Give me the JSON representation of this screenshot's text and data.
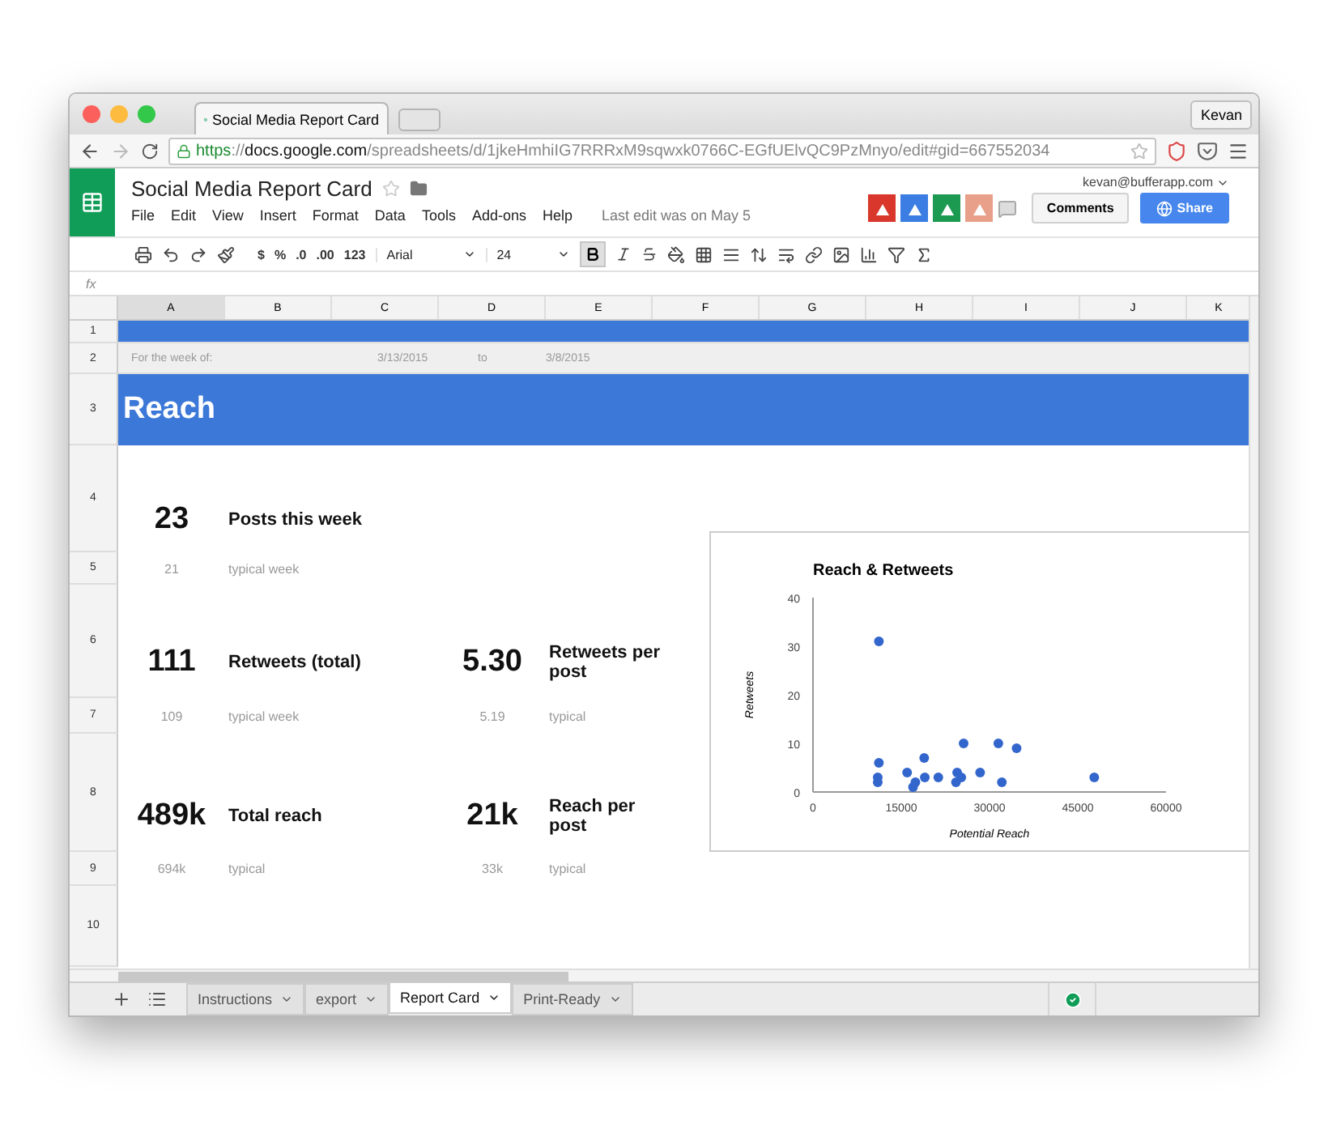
{
  "browser": {
    "tab_title": "Social Media Report Card",
    "profile": "Kevan",
    "url": {
      "scheme": "https",
      "separator": "://",
      "host": "docs.google.com",
      "path": "/spreadsheets/d/1jkeHmhiIG7RRRxM9sqwxk0766C-EGfUElvQC9PzMnyo/edit#gid=667552034"
    }
  },
  "doc": {
    "title": "Social Media Report Card",
    "user": "kevan@bufferapp.com",
    "menu": [
      "File",
      "Edit",
      "View",
      "Insert",
      "Format",
      "Data",
      "Tools",
      "Add-ons",
      "Help"
    ],
    "last_edit": "Last edit was on May 5",
    "comments_button": "Comments",
    "share_button": "Share"
  },
  "toolbar": {
    "currency": "$",
    "percent": "%",
    "decrease_decimals": ".0",
    "increase_decimals": ".00",
    "number_format": "123",
    "font": "Arial",
    "font_size": "24",
    "bold_on": true
  },
  "formula_bar": {
    "symbol": "fx"
  },
  "columns": [
    {
      "label": "A",
      "selected": true
    },
    {
      "label": "B",
      "selected": false
    },
    {
      "label": "C",
      "selected": false
    },
    {
      "label": "D",
      "selected": false
    },
    {
      "label": "E",
      "selected": false
    },
    {
      "label": "F",
      "selected": false
    },
    {
      "label": "G",
      "selected": false
    },
    {
      "label": "H",
      "selected": false
    },
    {
      "label": "I",
      "selected": false
    },
    {
      "label": "J",
      "selected": false
    },
    {
      "label": "K",
      "selected": false
    }
  ],
  "rows": [
    "1",
    "2",
    "3",
    "4",
    "5",
    "6",
    "7",
    "8",
    "9",
    "10"
  ],
  "week_row": {
    "label": "For the week of:",
    "start": "3/13/2015",
    "to": "to",
    "end": "3/8/2015"
  },
  "section_title": "Reach",
  "metric_rows": [
    [
      {
        "value": "23",
        "label": "Posts this week",
        "typical_value": "21",
        "typical_label": "typical week"
      }
    ],
    [
      {
        "value": "111",
        "label": "Retweets (total)",
        "typical_value": "109",
        "typical_label": "typical week"
      },
      {
        "value": "5.30",
        "label": "Retweets per post",
        "typical_value": "5.19",
        "typical_label": "typical"
      }
    ],
    [
      {
        "value": "489k",
        "label": "Total reach",
        "typical_value": "694k",
        "typical_label": "typical"
      },
      {
        "value": "21k",
        "label": "Reach per post",
        "typical_value": "33k",
        "typical_label": "typical"
      }
    ]
  ],
  "chart": {
    "chart_data": {
      "type": "scatter",
      "title": "Reach & Retweets",
      "xlabel": "Potential Reach",
      "ylabel": "Retweets",
      "x": [
        11200,
        11200,
        11000,
        11000,
        16000,
        17000,
        17400,
        18900,
        19000,
        21300,
        24500,
        24300,
        25200,
        25600,
        28400,
        31500,
        32100,
        34600,
        47800
      ],
      "series": [
        {
          "color": "#3366cc",
          "values": [
            31,
            6,
            3,
            2,
            4,
            1,
            2,
            7,
            3,
            3,
            4,
            2,
            3,
            10,
            4,
            10,
            2,
            9,
            3
          ]
        }
      ],
      "xlim": [
        0,
        60000
      ],
      "ylim": [
        0,
        40
      ],
      "xticks": [
        0,
        15000,
        30000,
        45000,
        60000
      ],
      "yticks": [
        0,
        10,
        20,
        30,
        40
      ]
    }
  },
  "sheet_tabs": [
    {
      "label": "Instructions",
      "selected": false
    },
    {
      "label": "export",
      "selected": false
    },
    {
      "label": "Report Card",
      "selected": true
    },
    {
      "label": "Print-Ready",
      "selected": false
    }
  ]
}
